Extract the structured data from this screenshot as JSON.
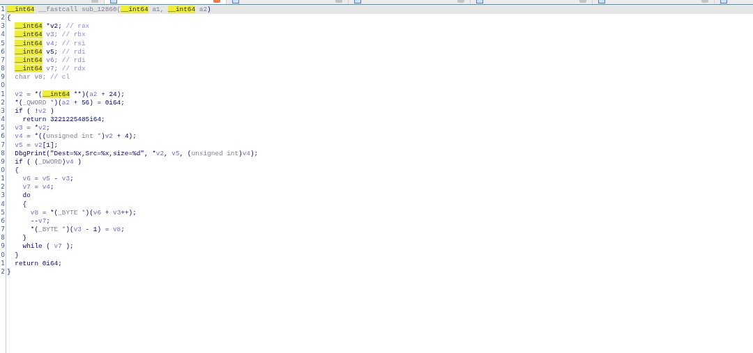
{
  "tabs": [
    {
      "selected": false
    },
    {
      "selected": true
    },
    {
      "selected": false
    },
    {
      "selected": false
    },
    {
      "selected": false
    },
    {
      "selected": false
    },
    {
      "selected": false
    }
  ],
  "pseudocode": {
    "lines": [
      {
        "number": "1",
        "current": true,
        "tokens": [
          {
            "text": "__int64",
            "kind": "hl"
          },
          {
            "text": " __fastcall sub_12860(",
            "kind": "cast"
          },
          {
            "text": "__int64",
            "kind": "hl"
          },
          {
            "text": " a1, ",
            "kind": "cast"
          },
          {
            "text": "__int64",
            "kind": "hl"
          },
          {
            "text": " a2",
            "kind": "cast"
          },
          {
            "text": ")",
            "kind": "code"
          }
        ]
      },
      {
        "number": "2",
        "current": false,
        "tokens": [
          {
            "text": "{",
            "kind": "code"
          }
        ]
      },
      {
        "number": "3",
        "current": false,
        "tokens": [
          {
            "text": "  __int64",
            "kind": "hl"
          },
          {
            "text": " *v2; ",
            "kind": "code"
          },
          {
            "text": "// rax",
            "kind": "comment"
          }
        ]
      },
      {
        "number": "4",
        "current": false,
        "tokens": [
          {
            "text": "  __int64",
            "kind": "hl"
          },
          {
            "text": " v3; ",
            "kind": "var"
          },
          {
            "text": "// rbx",
            "kind": "comment"
          }
        ]
      },
      {
        "number": "5",
        "current": false,
        "tokens": [
          {
            "text": "  __int64",
            "kind": "hl"
          },
          {
            "text": " v4; ",
            "kind": "var"
          },
          {
            "text": "// rsi",
            "kind": "comment"
          }
        ]
      },
      {
        "number": "6",
        "current": false,
        "tokens": [
          {
            "text": "  __int64",
            "kind": "hl"
          },
          {
            "text": " v5; ",
            "kind": "code"
          },
          {
            "text": "// rdi",
            "kind": "comment"
          }
        ]
      },
      {
        "number": "7",
        "current": false,
        "tokens": [
          {
            "text": "  __int64",
            "kind": "hl"
          },
          {
            "text": " v6; ",
            "kind": "var"
          },
          {
            "text": "// rdi",
            "kind": "comment"
          }
        ]
      },
      {
        "number": "8",
        "current": false,
        "tokens": [
          {
            "text": "  __int64",
            "kind": "hl"
          },
          {
            "text": " v7; ",
            "kind": "var"
          },
          {
            "text": "// rdx",
            "kind": "comment"
          }
        ]
      },
      {
        "number": "9",
        "current": false,
        "tokens": [
          {
            "text": "  char v8; ",
            "kind": "cast"
          },
          {
            "text": "// cl",
            "kind": "comment"
          }
        ]
      },
      {
        "number": "0",
        "current": false
      },
      {
        "number": "1",
        "current": false,
        "tokens": [
          {
            "text": "  v2",
            "kind": "var"
          },
          {
            "text": " = *(",
            "kind": "code"
          },
          {
            "text": "__int64",
            "kind": "hl"
          },
          {
            "text": " **)(",
            "kind": "code"
          },
          {
            "text": "a2",
            "kind": "var"
          },
          {
            "text": " + 24);",
            "kind": "code"
          }
        ]
      },
      {
        "number": "2",
        "current": false,
        "tokens": [
          {
            "text": "  *(",
            "kind": "code"
          },
          {
            "text": "_QWORD *",
            "kind": "cast"
          },
          {
            "text": ")(",
            "kind": "code"
          },
          {
            "text": "a2",
            "kind": "var"
          },
          {
            "text": " + 56) = 0i64;",
            "kind": "code"
          }
        ]
      },
      {
        "number": "3",
        "current": false,
        "tokens": [
          {
            "text": "  if ( !",
            "kind": "code"
          },
          {
            "text": "v2",
            "kind": "var"
          },
          {
            "text": " )",
            "kind": "code"
          }
        ]
      },
      {
        "number": "4",
        "current": false,
        "tokens": [
          {
            "text": "    return 3221225485i64;",
            "kind": "code"
          }
        ]
      },
      {
        "number": "5",
        "current": false,
        "tokens": [
          {
            "text": "  v3",
            "kind": "var"
          },
          {
            "text": " = *",
            "kind": "code"
          },
          {
            "text": "v2",
            "kind": "var"
          },
          {
            "text": ";",
            "kind": "code"
          }
        ]
      },
      {
        "number": "6",
        "current": false,
        "tokens": [
          {
            "text": "  v4",
            "kind": "var"
          },
          {
            "text": " = *((",
            "kind": "code"
          },
          {
            "text": "unsigned int *",
            "kind": "cast"
          },
          {
            "text": ")",
            "kind": "code"
          },
          {
            "text": "v2",
            "kind": "var"
          },
          {
            "text": " + 4);",
            "kind": "code"
          }
        ]
      },
      {
        "number": "7",
        "current": false,
        "tokens": [
          {
            "text": "  v5",
            "kind": "var"
          },
          {
            "text": " = ",
            "kind": "code"
          },
          {
            "text": "v2",
            "kind": "var"
          },
          {
            "text": "[1];",
            "kind": "code"
          }
        ]
      },
      {
        "number": "8",
        "current": false,
        "tokens": [
          {
            "text": "  DbgPrint(\"Dest=%x,Src=%x,size=%d\", *",
            "kind": "code"
          },
          {
            "text": "v2",
            "kind": "var"
          },
          {
            "text": ", ",
            "kind": "code"
          },
          {
            "text": "v5",
            "kind": "var"
          },
          {
            "text": ", (",
            "kind": "code"
          },
          {
            "text": "unsigned int",
            "kind": "cast"
          },
          {
            "text": ")",
            "kind": "code"
          },
          {
            "text": "v4",
            "kind": "var"
          },
          {
            "text": ");",
            "kind": "code"
          }
        ]
      },
      {
        "number": "9",
        "current": false,
        "tokens": [
          {
            "text": "  if ( (",
            "kind": "code"
          },
          {
            "text": "_DWORD",
            "kind": "cast"
          },
          {
            "text": ")",
            "kind": "code"
          },
          {
            "text": "v4",
            "kind": "var"
          },
          {
            "text": " )",
            "kind": "code"
          }
        ]
      },
      {
        "number": "0",
        "current": false,
        "tokens": [
          {
            "text": "  {",
            "kind": "code"
          }
        ]
      },
      {
        "number": "1",
        "current": false,
        "tokens": [
          {
            "text": "    v6",
            "kind": "var"
          },
          {
            "text": " = ",
            "kind": "code"
          },
          {
            "text": "v5",
            "kind": "var"
          },
          {
            "text": " - ",
            "kind": "code"
          },
          {
            "text": "v3",
            "kind": "var"
          },
          {
            "text": ";",
            "kind": "code"
          }
        ]
      },
      {
        "number": "2",
        "current": false,
        "tokens": [
          {
            "text": "    v7",
            "kind": "var"
          },
          {
            "text": " = ",
            "kind": "code"
          },
          {
            "text": "v4",
            "kind": "var"
          },
          {
            "text": ";",
            "kind": "code"
          }
        ]
      },
      {
        "number": "3",
        "current": false,
        "tokens": [
          {
            "text": "    do",
            "kind": "code"
          }
        ]
      },
      {
        "number": "4",
        "current": false,
        "tokens": [
          {
            "text": "    {",
            "kind": "code"
          }
        ]
      },
      {
        "number": "5",
        "current": false,
        "tokens": [
          {
            "text": "      v8",
            "kind": "var"
          },
          {
            "text": " = *(",
            "kind": "code"
          },
          {
            "text": "_BYTE *",
            "kind": "cast"
          },
          {
            "text": ")(",
            "kind": "code"
          },
          {
            "text": "v6",
            "kind": "var"
          },
          {
            "text": " + ",
            "kind": "code"
          },
          {
            "text": "v3",
            "kind": "var"
          },
          {
            "text": "++);",
            "kind": "code"
          }
        ]
      },
      {
        "number": "6",
        "current": false,
        "tokens": [
          {
            "text": "      --",
            "kind": "code"
          },
          {
            "text": "v7",
            "kind": "var"
          },
          {
            "text": ";",
            "kind": "code"
          }
        ]
      },
      {
        "number": "7",
        "current": false,
        "tokens": [
          {
            "text": "      *(",
            "kind": "code"
          },
          {
            "text": "_BYTE *",
            "kind": "cast"
          },
          {
            "text": ")(",
            "kind": "code"
          },
          {
            "text": "v3",
            "kind": "var"
          },
          {
            "text": " - 1) = ",
            "kind": "code"
          },
          {
            "text": "v8",
            "kind": "var"
          },
          {
            "text": ";",
            "kind": "code"
          }
        ]
      },
      {
        "number": "8",
        "current": false,
        "tokens": [
          {
            "text": "    }",
            "kind": "code"
          }
        ]
      },
      {
        "number": "9",
        "current": false,
        "tokens": [
          {
            "text": "    while ( ",
            "kind": "code"
          },
          {
            "text": "v7",
            "kind": "var"
          },
          {
            "text": " );",
            "kind": "code"
          }
        ]
      },
      {
        "number": "0",
        "current": false,
        "tokens": [
          {
            "text": "  }",
            "kind": "code"
          }
        ]
      },
      {
        "number": "1",
        "current": false,
        "tokens": [
          {
            "text": "  return 0i64;",
            "kind": "code"
          }
        ]
      },
      {
        "number": "2",
        "current": false,
        "tokens": [
          {
            "text": "}",
            "kind": "code"
          }
        ]
      }
    ]
  }
}
